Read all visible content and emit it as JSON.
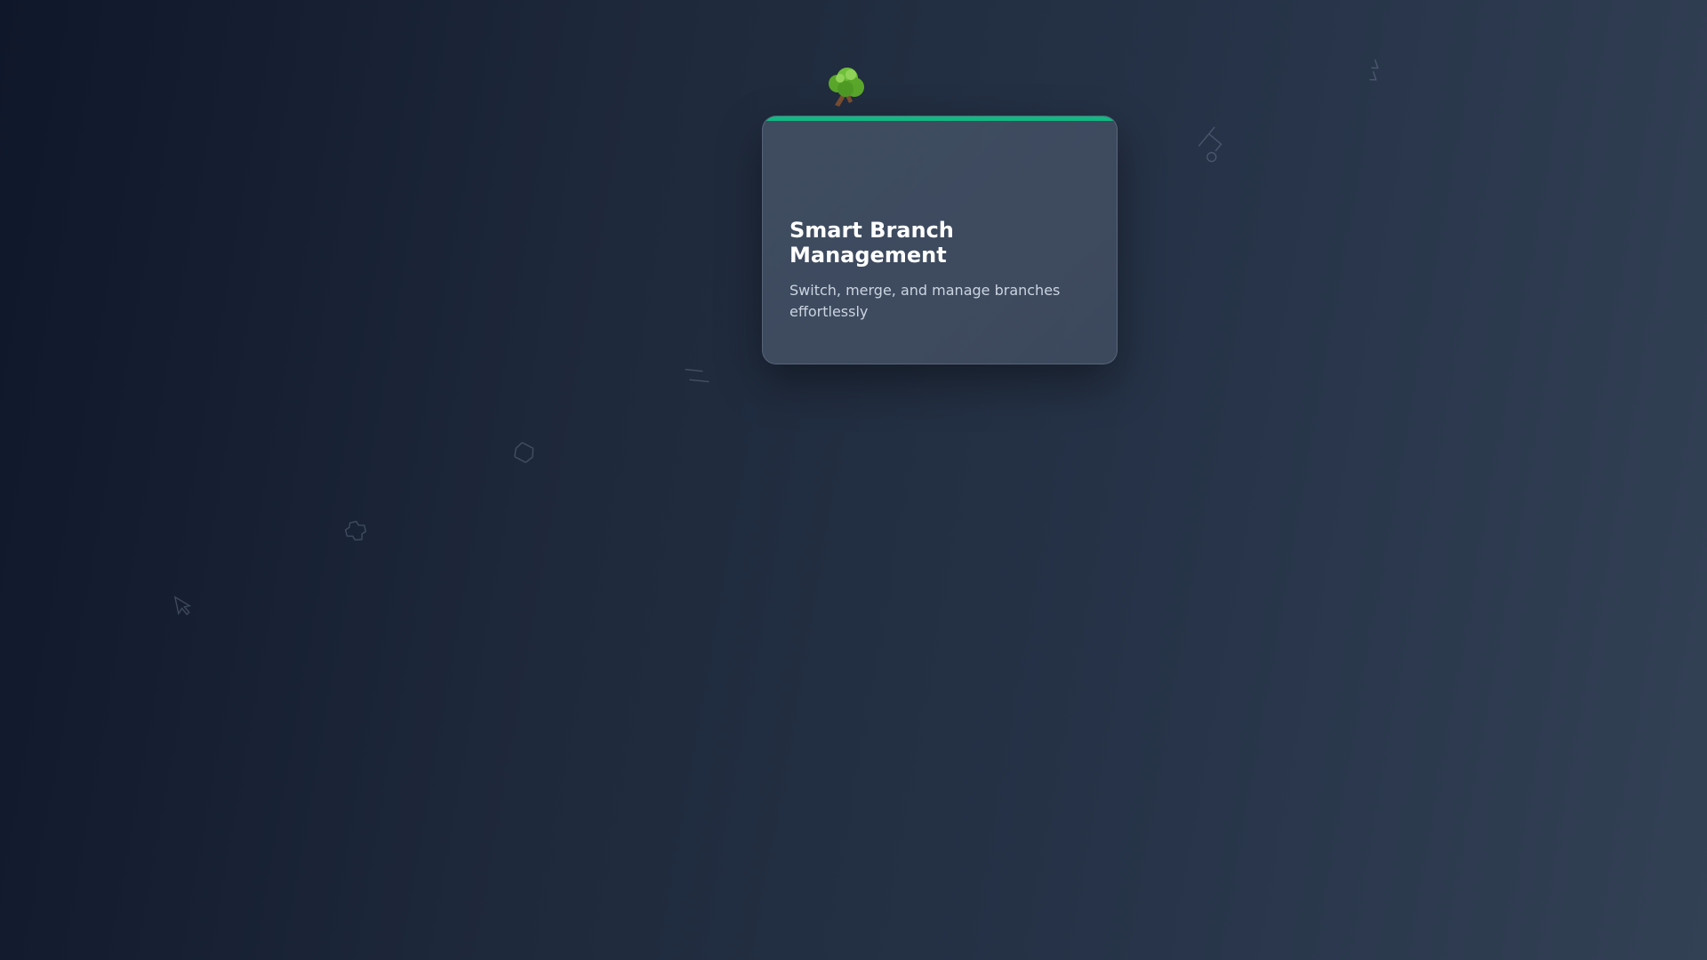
{
  "feature_card": {
    "icon": "tree-icon",
    "title": "Smart Branch Management",
    "description": "Switch, merge, and manage branches effortlessly"
  },
  "colors": {
    "background_start": "#0f172a",
    "background_end": "#334155",
    "accent": "#10b981",
    "card_title": "#ffffff",
    "card_text": "#cbd5e1"
  },
  "decorations": [
    "cursor-icon",
    "gear-icon",
    "bracket-icon",
    "lines-icon",
    "branch-icon",
    "sparkle-icon"
  ]
}
